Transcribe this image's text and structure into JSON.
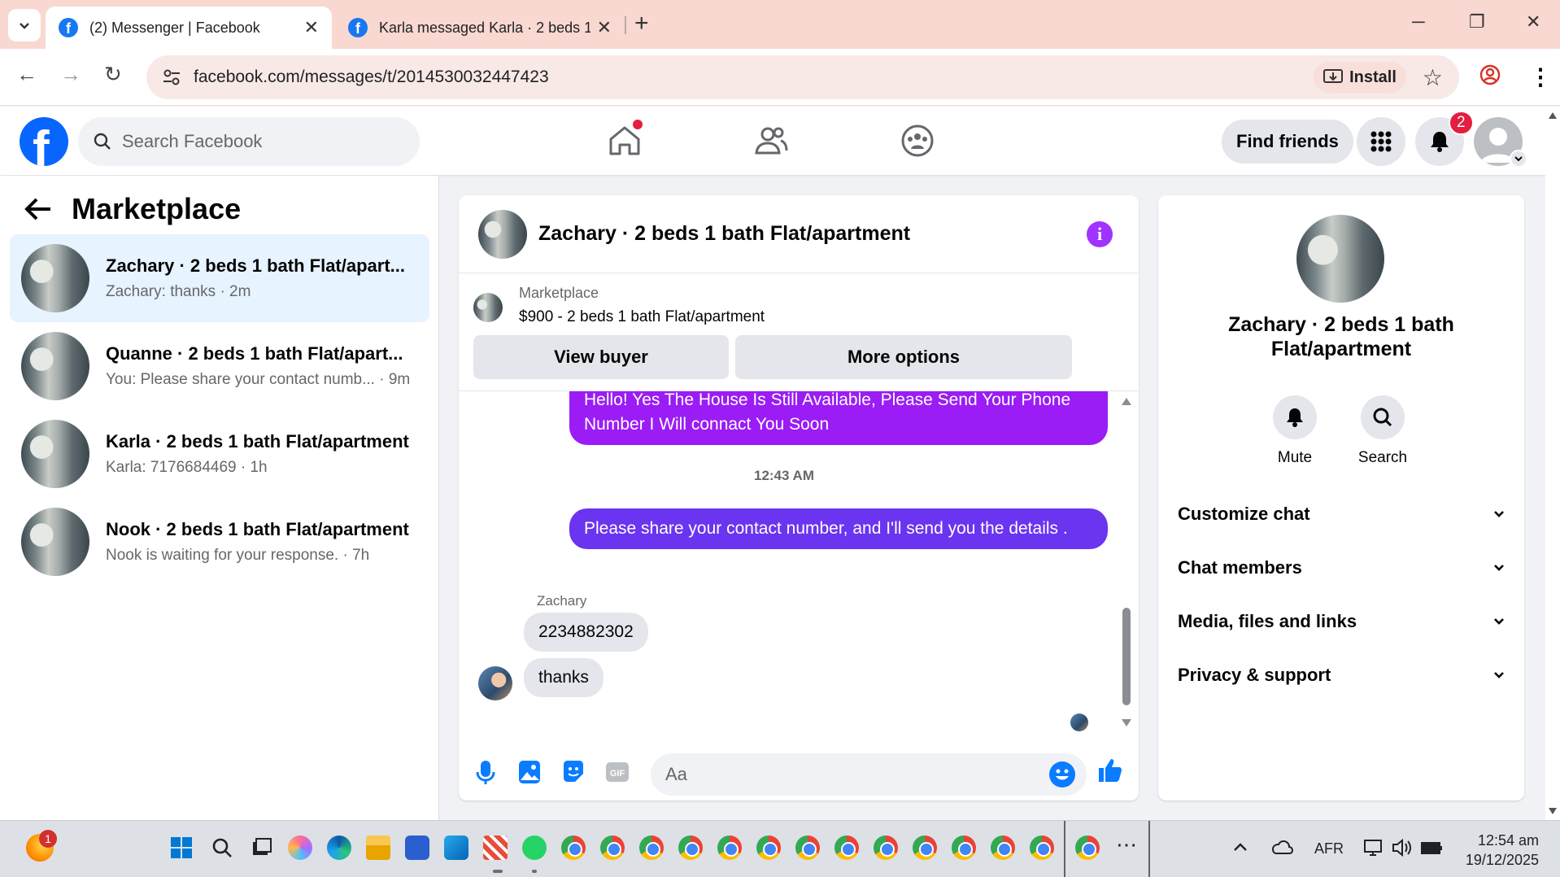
{
  "browser": {
    "tabs": [
      {
        "title": "(2) Messenger | Facebook",
        "active": true
      },
      {
        "title": "Karla messaged Karla · 2 beds 1",
        "active": false
      }
    ],
    "url": "facebook.com/messages/t/2014530032447423",
    "install_label": "Install"
  },
  "fb_header": {
    "search_placeholder": "Search Facebook",
    "find_friends_label": "Find friends",
    "notification_count": "2",
    "colors": {
      "brand": "#0866ff",
      "badge": "#e41e3f"
    }
  },
  "sidebar": {
    "title": "Marketplace",
    "conversations": [
      {
        "name": "Zachary · 2 beds 1 bath Flat/apart...",
        "preview": "Zachary: thanks · 2m",
        "active": true
      },
      {
        "name": "Quanne · 2 beds 1 bath Flat/apart...",
        "preview": "You: Please share your contact numb...  · 9m",
        "active": false
      },
      {
        "name": "Karla · 2 beds 1 bath Flat/apartment",
        "preview": "Karla: 7176684469 · 1h",
        "active": false
      },
      {
        "name": "Nook · 2 beds 1 bath Flat/apartment",
        "preview": "Nook is waiting for your response. · 7h",
        "active": false
      }
    ]
  },
  "chat": {
    "title": "Zachary · 2 beds 1 bath Flat/apartment",
    "marketplace_label": "Marketplace",
    "listing": "$900 - 2 beds 1 bath Flat/apartment",
    "view_buyer_label": "View buyer",
    "more_options_label": "More options",
    "messages": {
      "outgoing_1": "Hello! Yes The House  Is Still Available, Please Send Your Phone Number I Will connact You Soon",
      "timestamp": "12:43 AM",
      "outgoing_2": "Please share your contact number, and I'll send you the details .",
      "sender_name": "Zachary",
      "incoming_1": "2234882302",
      "incoming_2": "thanks"
    },
    "input_placeholder": "Aa",
    "colors": {
      "bubble_out_1": "#9b1cf5",
      "bubble_out_2": "#6a34f0",
      "accent": "#0a7cff"
    }
  },
  "right_panel": {
    "name": "Zachary · 2 beds 1 bath Flat/apartment",
    "mute_label": "Mute",
    "search_label": "Search",
    "sections": [
      "Customize chat",
      "Chat members",
      "Media, files and links",
      "Privacy & support"
    ]
  },
  "taskbar": {
    "notification_count": "1",
    "language": "AFR",
    "time": "12:54 am",
    "date": "19/12/2025"
  }
}
